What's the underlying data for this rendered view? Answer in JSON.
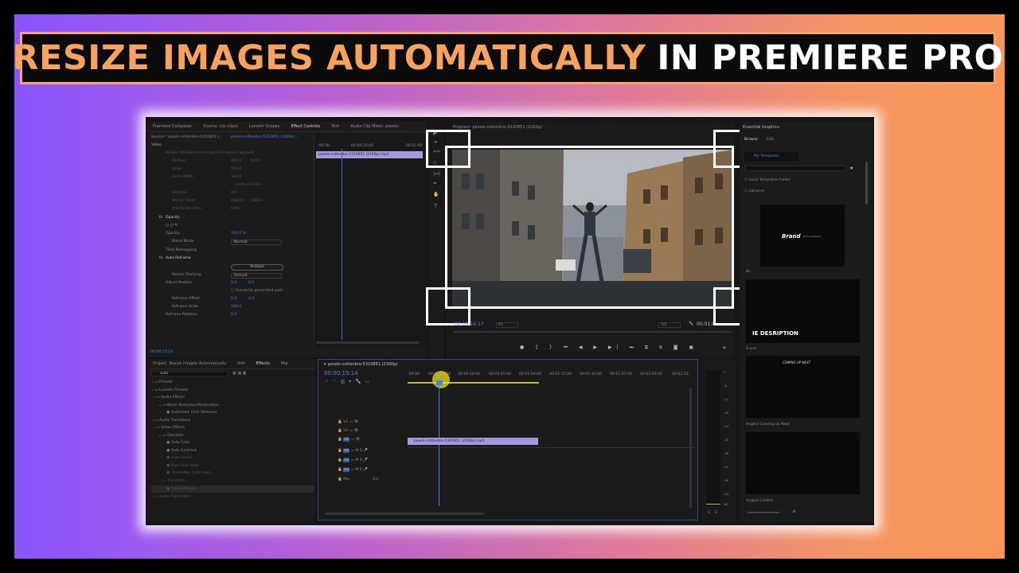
{
  "banner": {
    "title_part1": "RESIZE IMAGES AUTOMATICALLY",
    "title_part2": "IN PREMIERE PRO"
  },
  "left_top_panel": {
    "tabs": [
      "Premiere Composer",
      "Source: (no clips)",
      "Lumetri Scopes",
      "Effect Controls",
      "Text",
      "Audio Clip Mixer: pexels-"
    ],
    "active_tab": "Effect Controls",
    "source_label": "Source * pexels-cottonbro-5310851 (...",
    "clip_label": "pexels-cottonbro-5310851 (2160p)...",
    "section_video": "Video",
    "motion": "Motion (Disabled when Auto Reframe is applied)",
    "position": "Position",
    "position_x": "960.0",
    "position_y": "540.0",
    "scale": "Scale",
    "scale_val": "100.0",
    "scale_width": "Scale Width",
    "scale_width_val": "100.0",
    "uniform_scale": "Uniform Scale",
    "rotation": "Rotation",
    "rotation_val": "0.0",
    "anchor_point": "Anchor Point",
    "anchor_x": "1920.0",
    "anchor_y": "1080.0",
    "anti_flicker": "Anti-flicker Filter",
    "anti_flicker_val": "0.00",
    "opacity": "Opacity",
    "opacity_row": "Opacity",
    "opacity_val": "100.0 %",
    "blend_mode": "Blend Mode",
    "blend_val": "Normal",
    "time_remapping": "Time Remapping",
    "auto_reframe": "Auto Reframe",
    "analyze": "Analyze",
    "motion_tracking": "Motion Tracking",
    "motion_tracking_val": "Default",
    "adjust_position": "Adjust Position",
    "adjust_x": "0.0",
    "adjust_y": "0.0",
    "overwrite": "Overwrite generated path",
    "reframe_offset": "Reframe Offset",
    "offset_x": "0.0",
    "offset_y": "0.0",
    "reframe_scale": "Reframe Scale",
    "reframe_scale_val": "100.0",
    "reframe_rotation": "Reframe Rotation",
    "reframe_rotation_val": "0.0",
    "timecode": "00:00:15:14",
    "mini_tl_start": ":00:00",
    "mini_tl_mid": "00:00:30:00",
    "mini_tl_end": "00:01:00",
    "mini_clip": "pexels-cottonbro-5310851 (2160p).mp4"
  },
  "program": {
    "title": "Program: pexels-cottonbro-5310851 (2160p)",
    "timecode": "00:00:16:17",
    "fit": "Fit",
    "ratio": "1/2",
    "duration": "00:01:0"
  },
  "essential_graphics": {
    "title": "Essential Graphics",
    "tab_browse": "Browse",
    "tab_edit": "Edit",
    "my_templates": "My Templates",
    "local_templates": "Local Templates Folder",
    "libraries": "Libraries",
    "brand": "Brand",
    "brand_small": "Bold templates",
    "label1": "Bs",
    "desc": "IE DESRIPTION",
    "label2": "A one",
    "coming_up": "COMING UP NEXT",
    "label3": "Angled Coming Up Next",
    "label4": "Angled Credits"
  },
  "project": {
    "tabs": [
      "Project: Resize Images Automatically",
      "Info",
      "Effects",
      "Mar"
    ],
    "active_tab": "Effects",
    "search": "auto",
    "items": [
      "Presets",
      "Lumetri Presets",
      "Audio Effects",
      "Noise Reduction/Restoration",
      "Automatic Click Remover",
      "Audio Transitions",
      "Video Effects",
      "Obsolete",
      "Auto Color",
      "Auto Contrast",
      "Auto Levels",
      "Fast Color Auto",
      "Three-Way Color Auto",
      "Transform",
      "Auto Reframe",
      "Video Transitions"
    ]
  },
  "timeline": {
    "seq_name": "pexels-cottonbro-5310851 (2160p)",
    "timecode": "00:00:15:14",
    "ruler": [
      ":00:00",
      "00:00:15:00",
      "00:00:30:00",
      "00:00:45:00",
      "00:01:00:00",
      "00:01:15:00",
      "00:01:30:00",
      "00:01:45:00",
      "00:02:00:00",
      "00:02:15:"
    ],
    "tracks_v": [
      "V3",
      "V2",
      "V1"
    ],
    "tracks_a": [
      "A1",
      "A2",
      "A3"
    ],
    "mix": "Mix",
    "mix_val": "0.0",
    "clip": "pexels-cottonbro-5310851 (2160p).mp4",
    "meter_scale": [
      "0",
      "-6",
      "-12",
      "-18",
      "-24",
      "-30",
      "-36",
      "-42",
      "-48",
      "-54",
      "dB"
    ],
    "meter_solo": [
      "S",
      "S"
    ]
  }
}
